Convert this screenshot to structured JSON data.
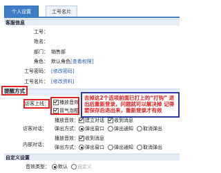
{
  "tabs": {
    "personal": "个人设置",
    "card": "工号名片"
  },
  "basic": {
    "header": "客服信息",
    "rows": [
      {
        "label": "工号：",
        "value": ""
      },
      {
        "label": "姓名：",
        "value": ""
      },
      {
        "label": "部门：",
        "value": "销售部"
      },
      {
        "label": "角色：",
        "value": "默认角色",
        "link": "[查看权限]"
      },
      {
        "label": "工号密码：",
        "link": "[修改密码]"
      },
      {
        "label": "工号名片：",
        "link": "[修改资料]"
      }
    ]
  },
  "reminder": {
    "header": "提醒方式",
    "online_label": "访客上线：",
    "options": {
      "sound": "播放音效",
      "bubble": "冒气泡框"
    },
    "annotation": "去掉这2个选项前面已打上的“打钩” 退出后重新登录，问题就可以解决掉 记得要保存后退出来，重新登录才有效",
    "visitor_dialog": {
      "label": "访客对话：",
      "row1": {
        "prefix": "播放音效：",
        "opt1": "建立对话",
        "opt2": "收到消息"
      },
      "row2": {
        "prefix": "弹出方式：",
        "opt1": "弹出窗口",
        "opt2": "弹出通知",
        "opt3": "取消弹出"
      }
    },
    "internal_dialog": {
      "label": "内部对话：",
      "row1": {
        "prefix": "播放音效：",
        "opt1": "收到消息"
      },
      "row2": {
        "prefix": "弹出方式：",
        "opt1": "弹出窗口",
        "opt2": "弹出通知",
        "opt3": "取消弹出"
      }
    }
  },
  "custom": {
    "header": "自定义设置",
    "sound_type_label": "音效类型：",
    "opt_default": "默认",
    "opt_custom": "自定义"
  }
}
